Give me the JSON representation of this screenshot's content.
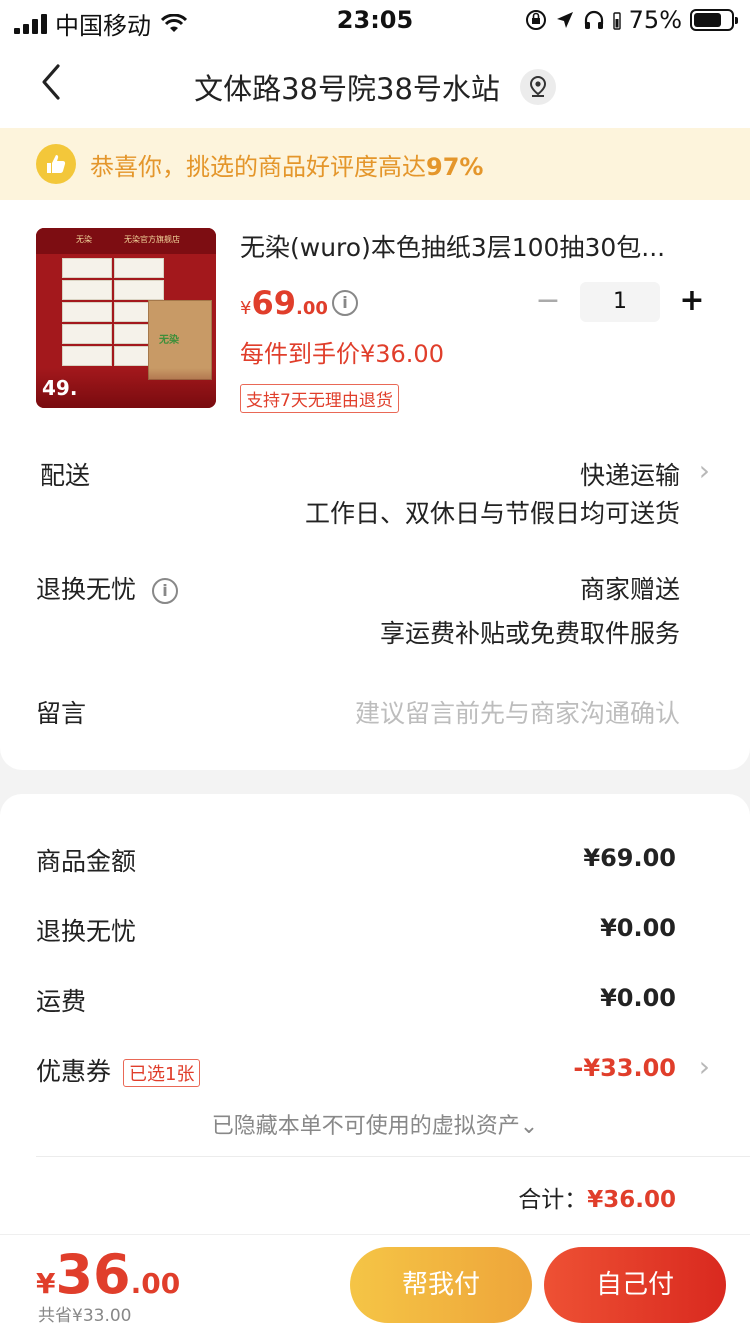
{
  "status_bar": {
    "carrier": "中国移动",
    "time": "23:05",
    "battery": "75%",
    "battery_level": 0.75
  },
  "nav": {
    "title": "文体路38号院38号水站"
  },
  "banner": {
    "text": "恭喜你，挑选的商品好评度高达",
    "percent": "97%"
  },
  "product": {
    "title": "无染(wuro)本色抽纸3层100抽30包...",
    "currency": "¥",
    "price_int": "69",
    "price_dec": ".00",
    "quantity": "1",
    "final_price": "每件到手价¥36.00",
    "return_badge": "支持7天无理由退货",
    "image": {
      "banner_left": "无染",
      "banner_right": "无染官方旗舰店",
      "price": "49.",
      "box_logo": "无染"
    }
  },
  "delivery": {
    "label": "配送",
    "method": "快递运输",
    "detail": "工作日、双休日与节假日均可送货"
  },
  "exchange": {
    "label": "退换无忧",
    "value": "商家赠送",
    "detail": "享运费补贴或免费取件服务"
  },
  "message": {
    "label": "留言",
    "placeholder": "建议留言前先与商家沟通确认"
  },
  "summary": {
    "goods_label": "商品金额",
    "goods_value": "¥69.00",
    "exchange_label": "退换无忧",
    "exchange_value": "¥0.00",
    "shipping_label": "运费",
    "shipping_value": "¥0.00",
    "coupon_label": "优惠券",
    "coupon_badge": "已选1张",
    "coupon_value": "-¥33.00",
    "hidden_assets": "已隐藏本单不可使用的虚拟资产⌄",
    "total_label": "合计：",
    "total_value": "¥36.00"
  },
  "bottom": {
    "currency": "¥",
    "price_int": "36",
    "price_dec": ".00",
    "saved": "共省¥33.00",
    "help_pay": "帮我付",
    "self_pay": "自己付"
  },
  "colors": {
    "accent": "#e03e2b",
    "banner_bg": "#fdf4dc",
    "banner_text": "#e4962b",
    "help_btn": "#f0b03e",
    "self_btn": "#e23a28"
  }
}
